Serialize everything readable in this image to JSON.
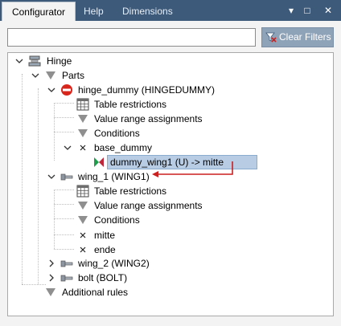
{
  "tabs": [
    {
      "label": "Configurator",
      "active": true
    },
    {
      "label": "Help",
      "active": false
    },
    {
      "label": "Dimensions",
      "active": false
    }
  ],
  "window_buttons": {
    "pin": "▾",
    "dock": "□",
    "close": "✕"
  },
  "search": {
    "value": "",
    "placeholder": ""
  },
  "clear_filters": {
    "label": "Clear Filters",
    "icon": "filter-clear-icon"
  },
  "colors": {
    "tab_strip": "#3e5a7a",
    "button_bg": "#8fa3b8",
    "selection": "#b8cce4",
    "annotation_arrow": "#cc1f1f",
    "condition_icon": "#8f8f8f",
    "no_entry": "#d9261c"
  },
  "tree": {
    "root": {
      "label": "Hinge",
      "icon": "assembly-icon"
    },
    "parts": {
      "label": "Parts",
      "icon": "funnel-icon"
    },
    "hinge_dummy": {
      "label": "hinge_dummy (HINGEDUMMY)",
      "icon": "no-entry-icon"
    },
    "hd_table": {
      "label": "Table restrictions",
      "icon": "table-icon"
    },
    "hd_value": {
      "label": "Value range assignments",
      "icon": "funnel-icon"
    },
    "hd_cond": {
      "label": "Conditions",
      "icon": "funnel-icon"
    },
    "base_dummy": {
      "label": "base_dummy",
      "icon": "cross-icon"
    },
    "dummy_wing1": {
      "label": "dummy_wing1 (U) -> mitte",
      "icon": "mate-icon"
    },
    "wing_1": {
      "label": "wing_1 (WING1)",
      "icon": "part-icon"
    },
    "w1_table": {
      "label": "Table restrictions",
      "icon": "table-icon"
    },
    "w1_value": {
      "label": "Value range assignments",
      "icon": "funnel-icon"
    },
    "w1_cond": {
      "label": "Conditions",
      "icon": "funnel-icon"
    },
    "mitte": {
      "label": "mitte",
      "icon": "cross-icon"
    },
    "ende": {
      "label": "ende",
      "icon": "cross-icon"
    },
    "wing_2": {
      "label": "wing_2 (WING2)",
      "icon": "part-icon"
    },
    "bolt": {
      "label": "bolt (BOLT)",
      "icon": "part-icon"
    },
    "additional": {
      "label": "Additional rules",
      "icon": "funnel-icon"
    }
  }
}
